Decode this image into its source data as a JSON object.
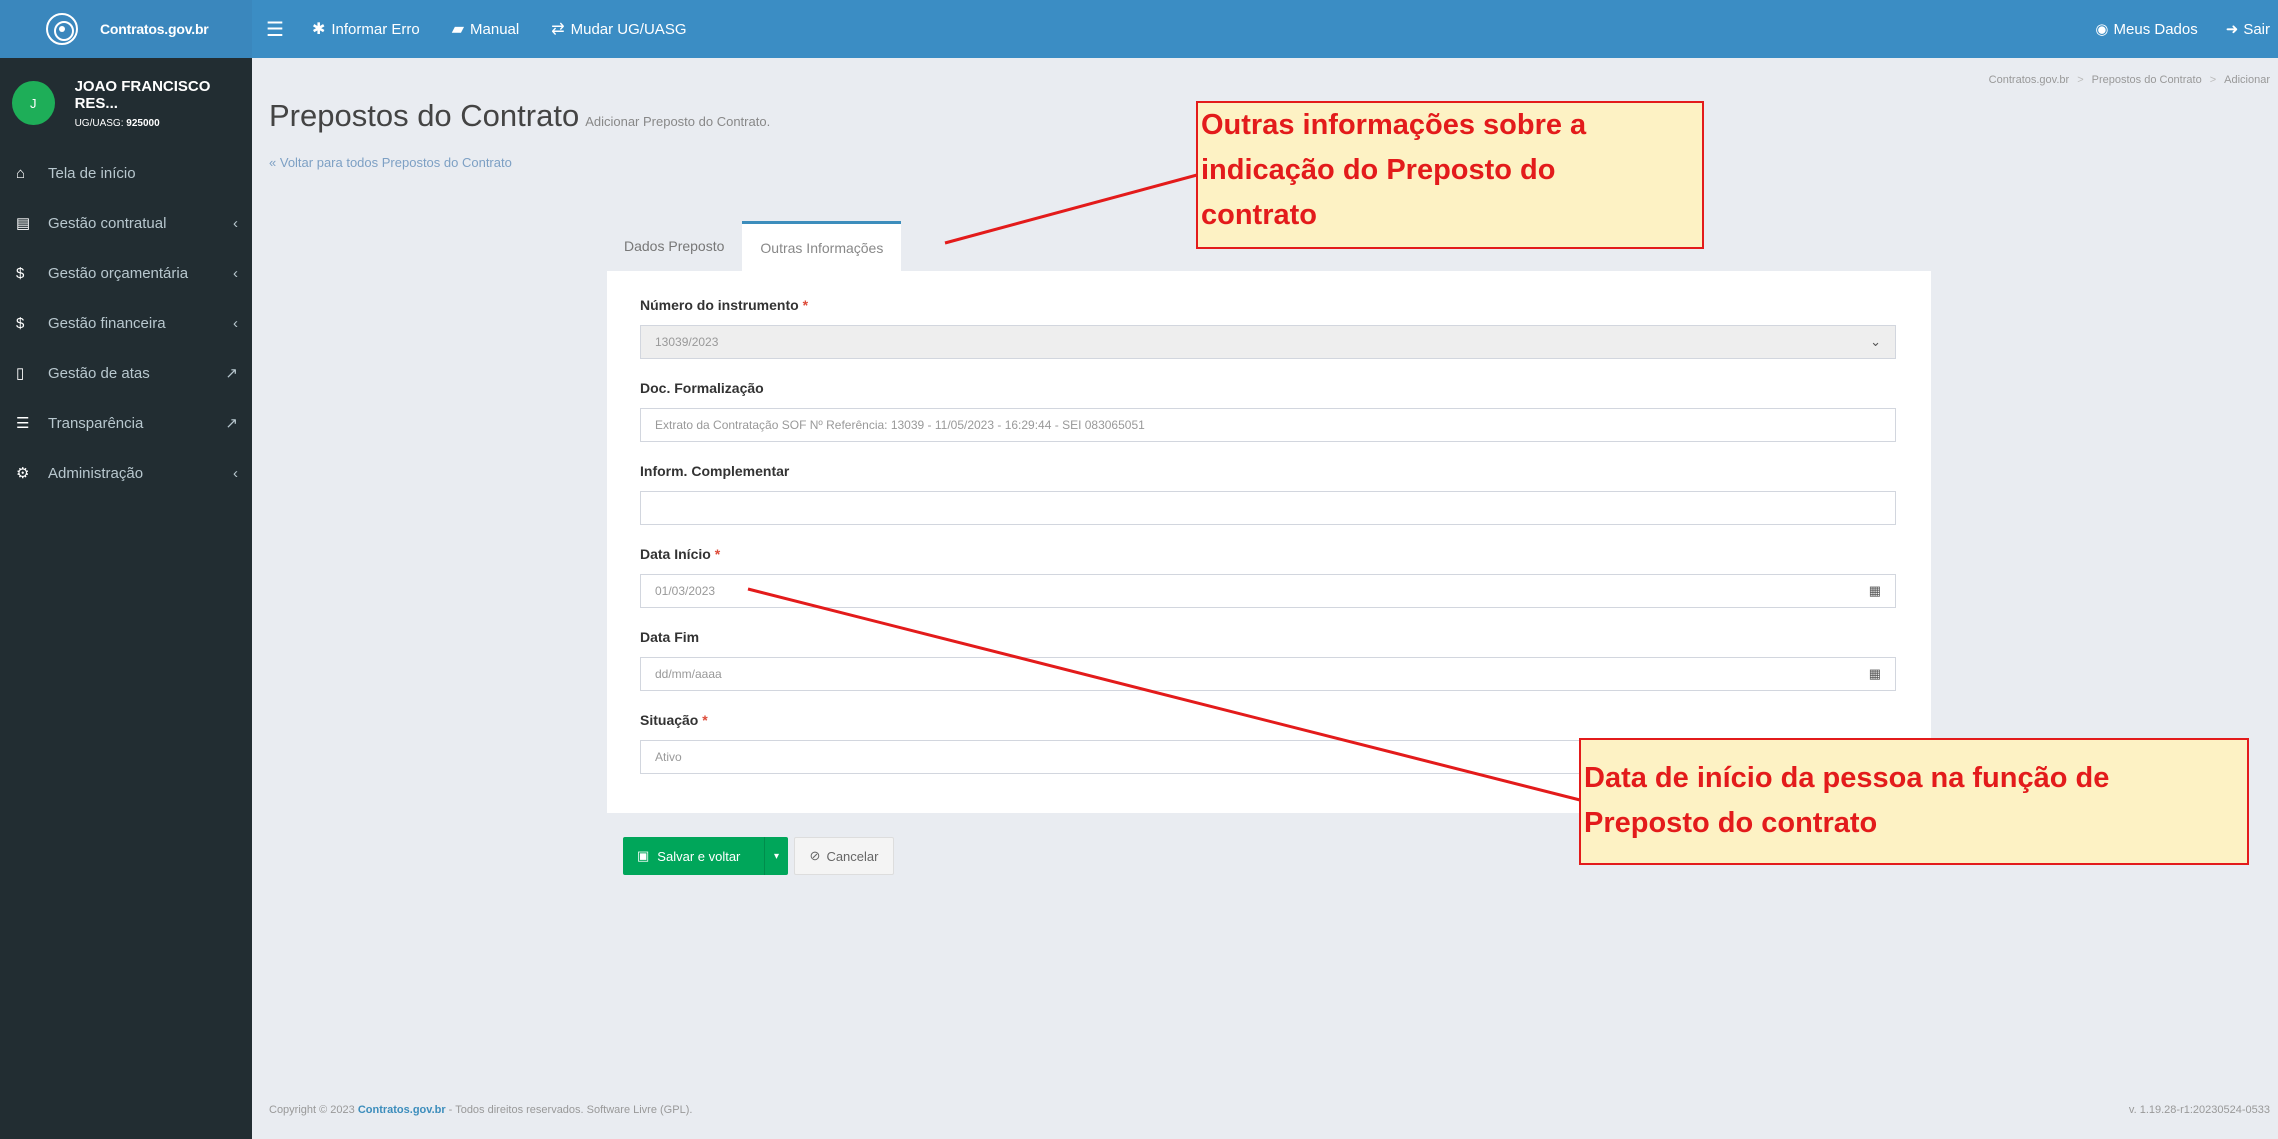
{
  "topbar": {
    "brand": "Contratos.gov.br",
    "menu_icon": "hamburger-icon",
    "nav": [
      {
        "icon": "bug-icon",
        "label": "Informar Erro"
      },
      {
        "icon": "book-icon",
        "label": "Manual"
      },
      {
        "icon": "exchange-icon",
        "label": "Mudar UG/UASG"
      }
    ],
    "right": [
      {
        "icon": "user-circle-icon",
        "label": "Meus Dados"
      },
      {
        "icon": "sign-out-icon",
        "label": "Sair"
      }
    ]
  },
  "sidebar": {
    "avatar_letter": "J",
    "user_name": "JOAO FRANCISCO RES...",
    "ug_label": "UG/UASG: ",
    "ug_value": "925000",
    "items": [
      {
        "icon": "home-icon",
        "label": "Tela de início"
      },
      {
        "icon": "file-text-icon",
        "label": "Gestão contratual"
      },
      {
        "icon": "dollar-icon",
        "label": "Gestão orçamentária"
      },
      {
        "icon": "dollar-icon",
        "label": "Gestão financeira"
      },
      {
        "icon": "file-icon",
        "label": "Gestão de atas"
      },
      {
        "icon": "list-icon",
        "label": "Transparência"
      },
      {
        "icon": "cogs-icon",
        "label": "Administração"
      }
    ]
  },
  "breadcrumb": [
    "Contratos.gov.br",
    "Prepostos do Contrato",
    "Adicionar"
  ],
  "page": {
    "title": "Prepostos do Contrato",
    "subtitle": "Adicionar Preposto do Contrato.",
    "back_link": "Voltar para todos Prepostos do Contrato"
  },
  "tabs": [
    {
      "label": "Dados Preposto",
      "active": false
    },
    {
      "label": "Outras Informações",
      "active": true
    }
  ],
  "form": {
    "numero_label": "Número do instrumento",
    "numero_value": "13039/2023",
    "doc_label": "Doc. Formalização",
    "doc_value": "Extrato da Contratação SOF Nº Referência: 13039 - 11/05/2023 - 16:29:44 - SEI 083065051",
    "inform_label": "Inform. Complementar",
    "inform_value": "",
    "data_inicio_label": "Data Início",
    "data_inicio_value": "01/03/2023",
    "data_fim_label": "Data Fim",
    "data_fim_placeholder": "dd/mm/aaaa",
    "situacao_label": "Situação",
    "situacao_value": "Ativo",
    "required_mark": "*"
  },
  "buttons": {
    "save": "Salvar e voltar",
    "cancel": "Cancelar"
  },
  "footer": {
    "copyright_prefix": "Copyright © 2023 ",
    "brand": "Contratos.gov.br",
    "copyright_suffix": " - Todos direitos reservados. Software Livre (GPL).",
    "version": "v. 1.19.28-r1:20230524-0533"
  },
  "callouts": {
    "top": [
      "Outras informações sobre a",
      "indicação do Preposto do",
      "contrato"
    ],
    "bottom": [
      "Data de início da pessoa na função de",
      "Preposto do contrato"
    ],
    "color": "#e31b1b",
    "background": "#fdf2c4"
  },
  "colors": {
    "topbar": "#3b8dc4",
    "sidebar": "#222d32",
    "save_button": "#00a65a",
    "required": "#dd4b39"
  }
}
